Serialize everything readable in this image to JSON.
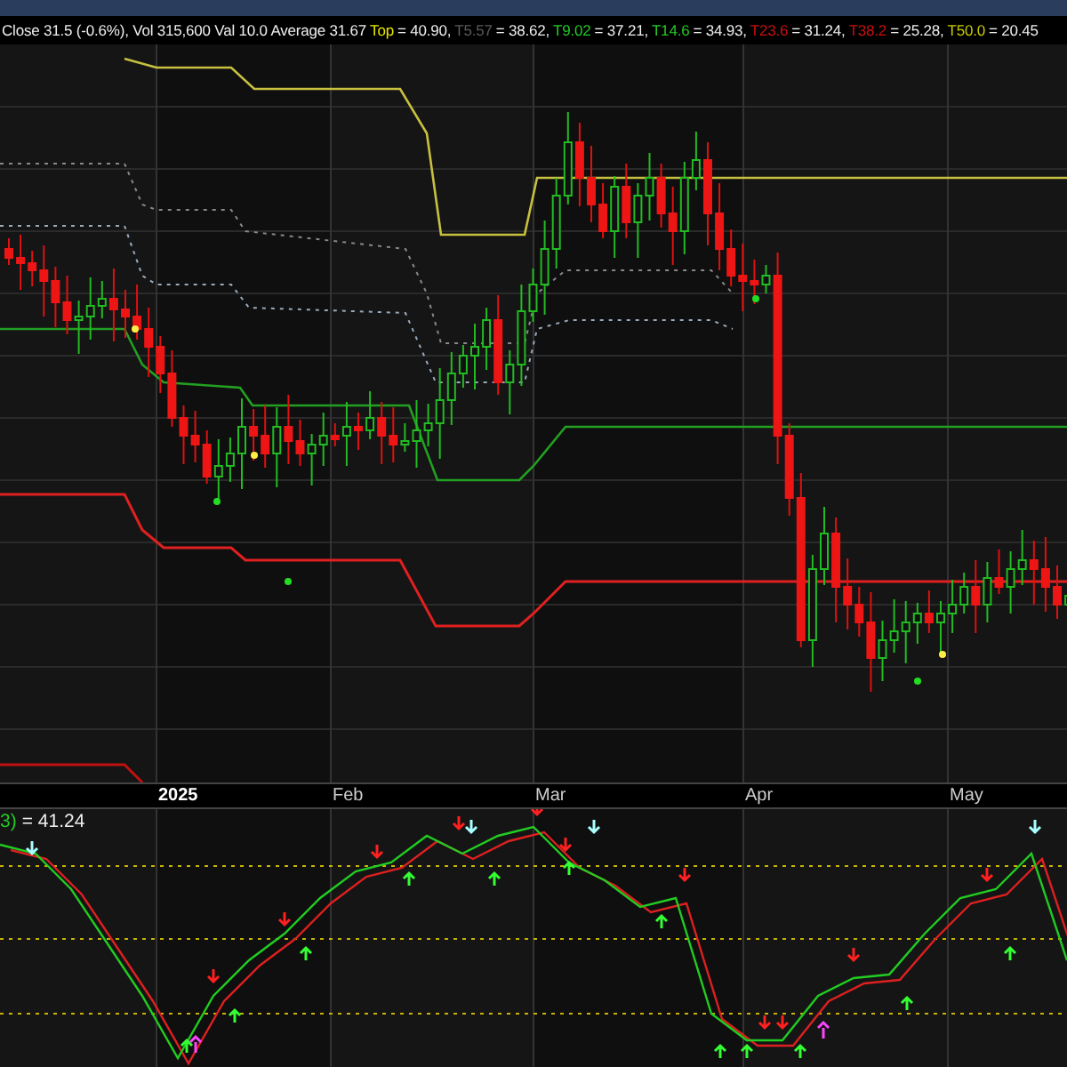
{
  "header": {
    "summary": "Close 31.5 (-0.6%), Vol 315,600 Val 10.0 Average 31.67",
    "legend": [
      {
        "label": "Top",
        "value": "= 40.90,",
        "color": "#e6e600"
      },
      {
        "label": "T5.57",
        "value": "= 38.62,",
        "color": "#5a5a5a"
      },
      {
        "label": "T9.02",
        "value": "= 37.21,",
        "color": "#22cc22"
      },
      {
        "label": "T14.6",
        "value": "= 34.93,",
        "color": "#22cc22"
      },
      {
        "label": "T23.6",
        "value": "= 31.24,",
        "color": "#cc1010"
      },
      {
        "label": "T38.2",
        "value": "= 25.28,",
        "color": "#cc1010"
      },
      {
        "label": "T50.0",
        "value": "= 20.45",
        "color": "#c8c800"
      }
    ]
  },
  "date_axis": {
    "labels": [
      {
        "text": "2025",
        "bold": true
      },
      {
        "text": "Feb",
        "bold": false
      },
      {
        "text": "Mar",
        "bold": false
      },
      {
        "text": "Apr",
        "bold": false
      },
      {
        "text": "May",
        "bold": false
      }
    ]
  },
  "oscillator": {
    "label_prefix": "3)",
    "label_value": "= 41.24"
  }
}
